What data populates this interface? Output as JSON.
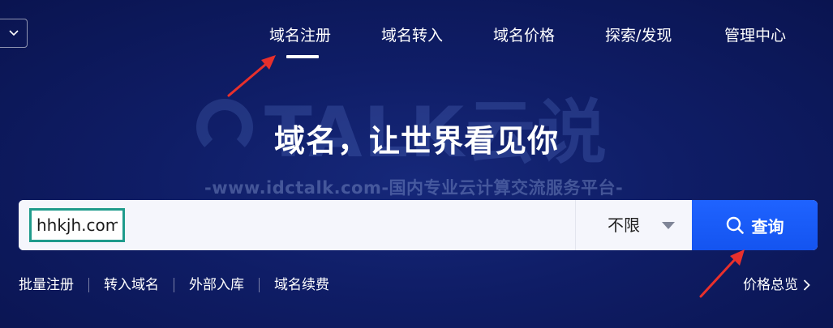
{
  "nav": {
    "items": [
      {
        "label": "域名注册",
        "active": true
      },
      {
        "label": "域名转入",
        "active": false
      },
      {
        "label": "域名价格",
        "active": false
      },
      {
        "label": "探索/发现",
        "active": false
      },
      {
        "label": "管理中心",
        "active": false
      }
    ]
  },
  "watermark": {
    "logo_text": "TALK云说",
    "url_text": "-www.idctalk.com-国内专业云计算交流服务平台-"
  },
  "hero": {
    "headline": "域名，让世界看见你"
  },
  "search": {
    "input_value": "hhkjh.com",
    "suffix_selected": "不限",
    "button_label": "查询"
  },
  "quick_links": {
    "items": [
      "批量注册",
      "转入域名",
      "外部入库",
      "域名续费"
    ],
    "price_overview": "价格总览"
  },
  "colors": {
    "background": "#0f1d66",
    "search_button": "#1f5cff",
    "input_highlight_border": "#1f9b8c",
    "annotation_arrow": "#e8302c"
  },
  "icons": {
    "corner_dropdown": "chevron-down-icon",
    "suffix_caret": "caret-down-icon",
    "search_button": "search-icon",
    "price_overview": "chevron-right-icon"
  }
}
